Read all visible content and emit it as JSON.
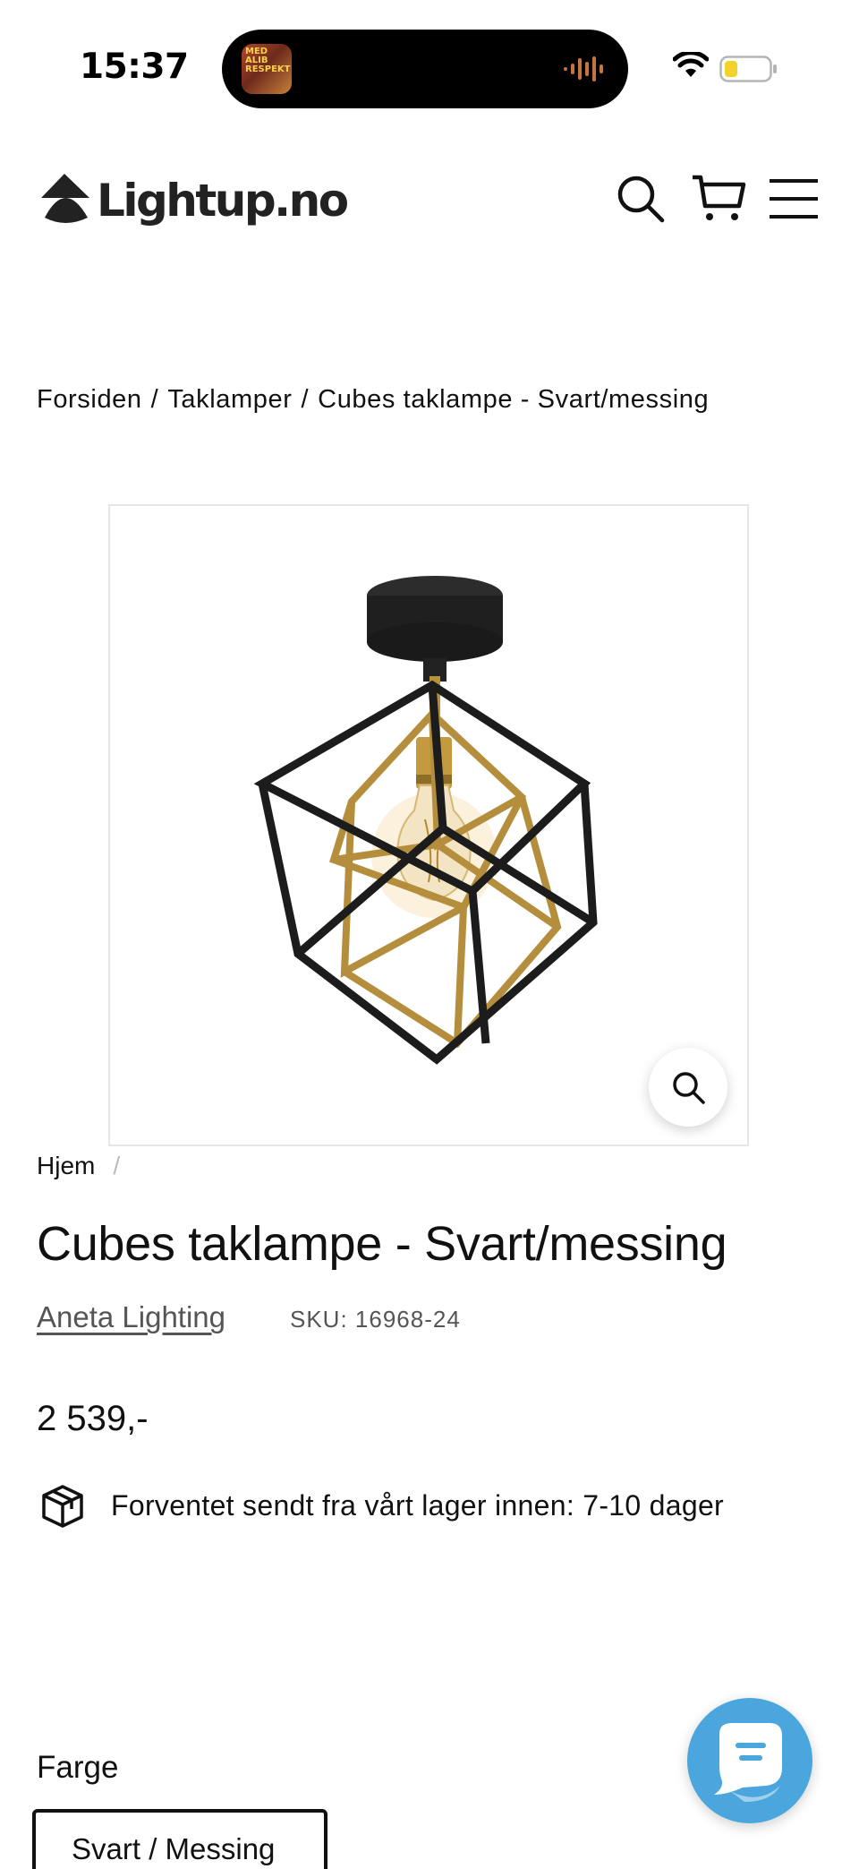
{
  "status_bar": {
    "time": "15:37",
    "now_playing_art_text": "MED ALIB RESPEKT",
    "wifi_icon": "wifi-icon",
    "battery_icon": "battery-icon",
    "battery_color": "#f3d229"
  },
  "header": {
    "logo_text": "Lightup.no",
    "icons": [
      "search-icon",
      "cart-icon",
      "menu-icon"
    ]
  },
  "breadcrumb": {
    "items": [
      "Forsiden",
      "Taklamper",
      "Cubes taklampe - Svart/messing"
    ],
    "separator": "/"
  },
  "product": {
    "image_alt": "Cubes taklampe - Svart/messing",
    "zoom_icon": "zoom-icon",
    "secondary_crumb": "Hjem",
    "secondary_crumb_sep": "/",
    "title": "Cubes taklampe - Svart/messing",
    "vendor": "Aneta Lighting",
    "sku": "SKU: 16968-24",
    "price": "2 539,-",
    "shipping_text": "Forventet sendt fra vårt lager innen: 7-10 dager",
    "shipping_icon": "box-icon"
  },
  "options": {
    "label": "Farge",
    "selected": "Svart / Messing"
  },
  "chat": {
    "icon": "chat-icon",
    "color": "#4aa6dc"
  }
}
